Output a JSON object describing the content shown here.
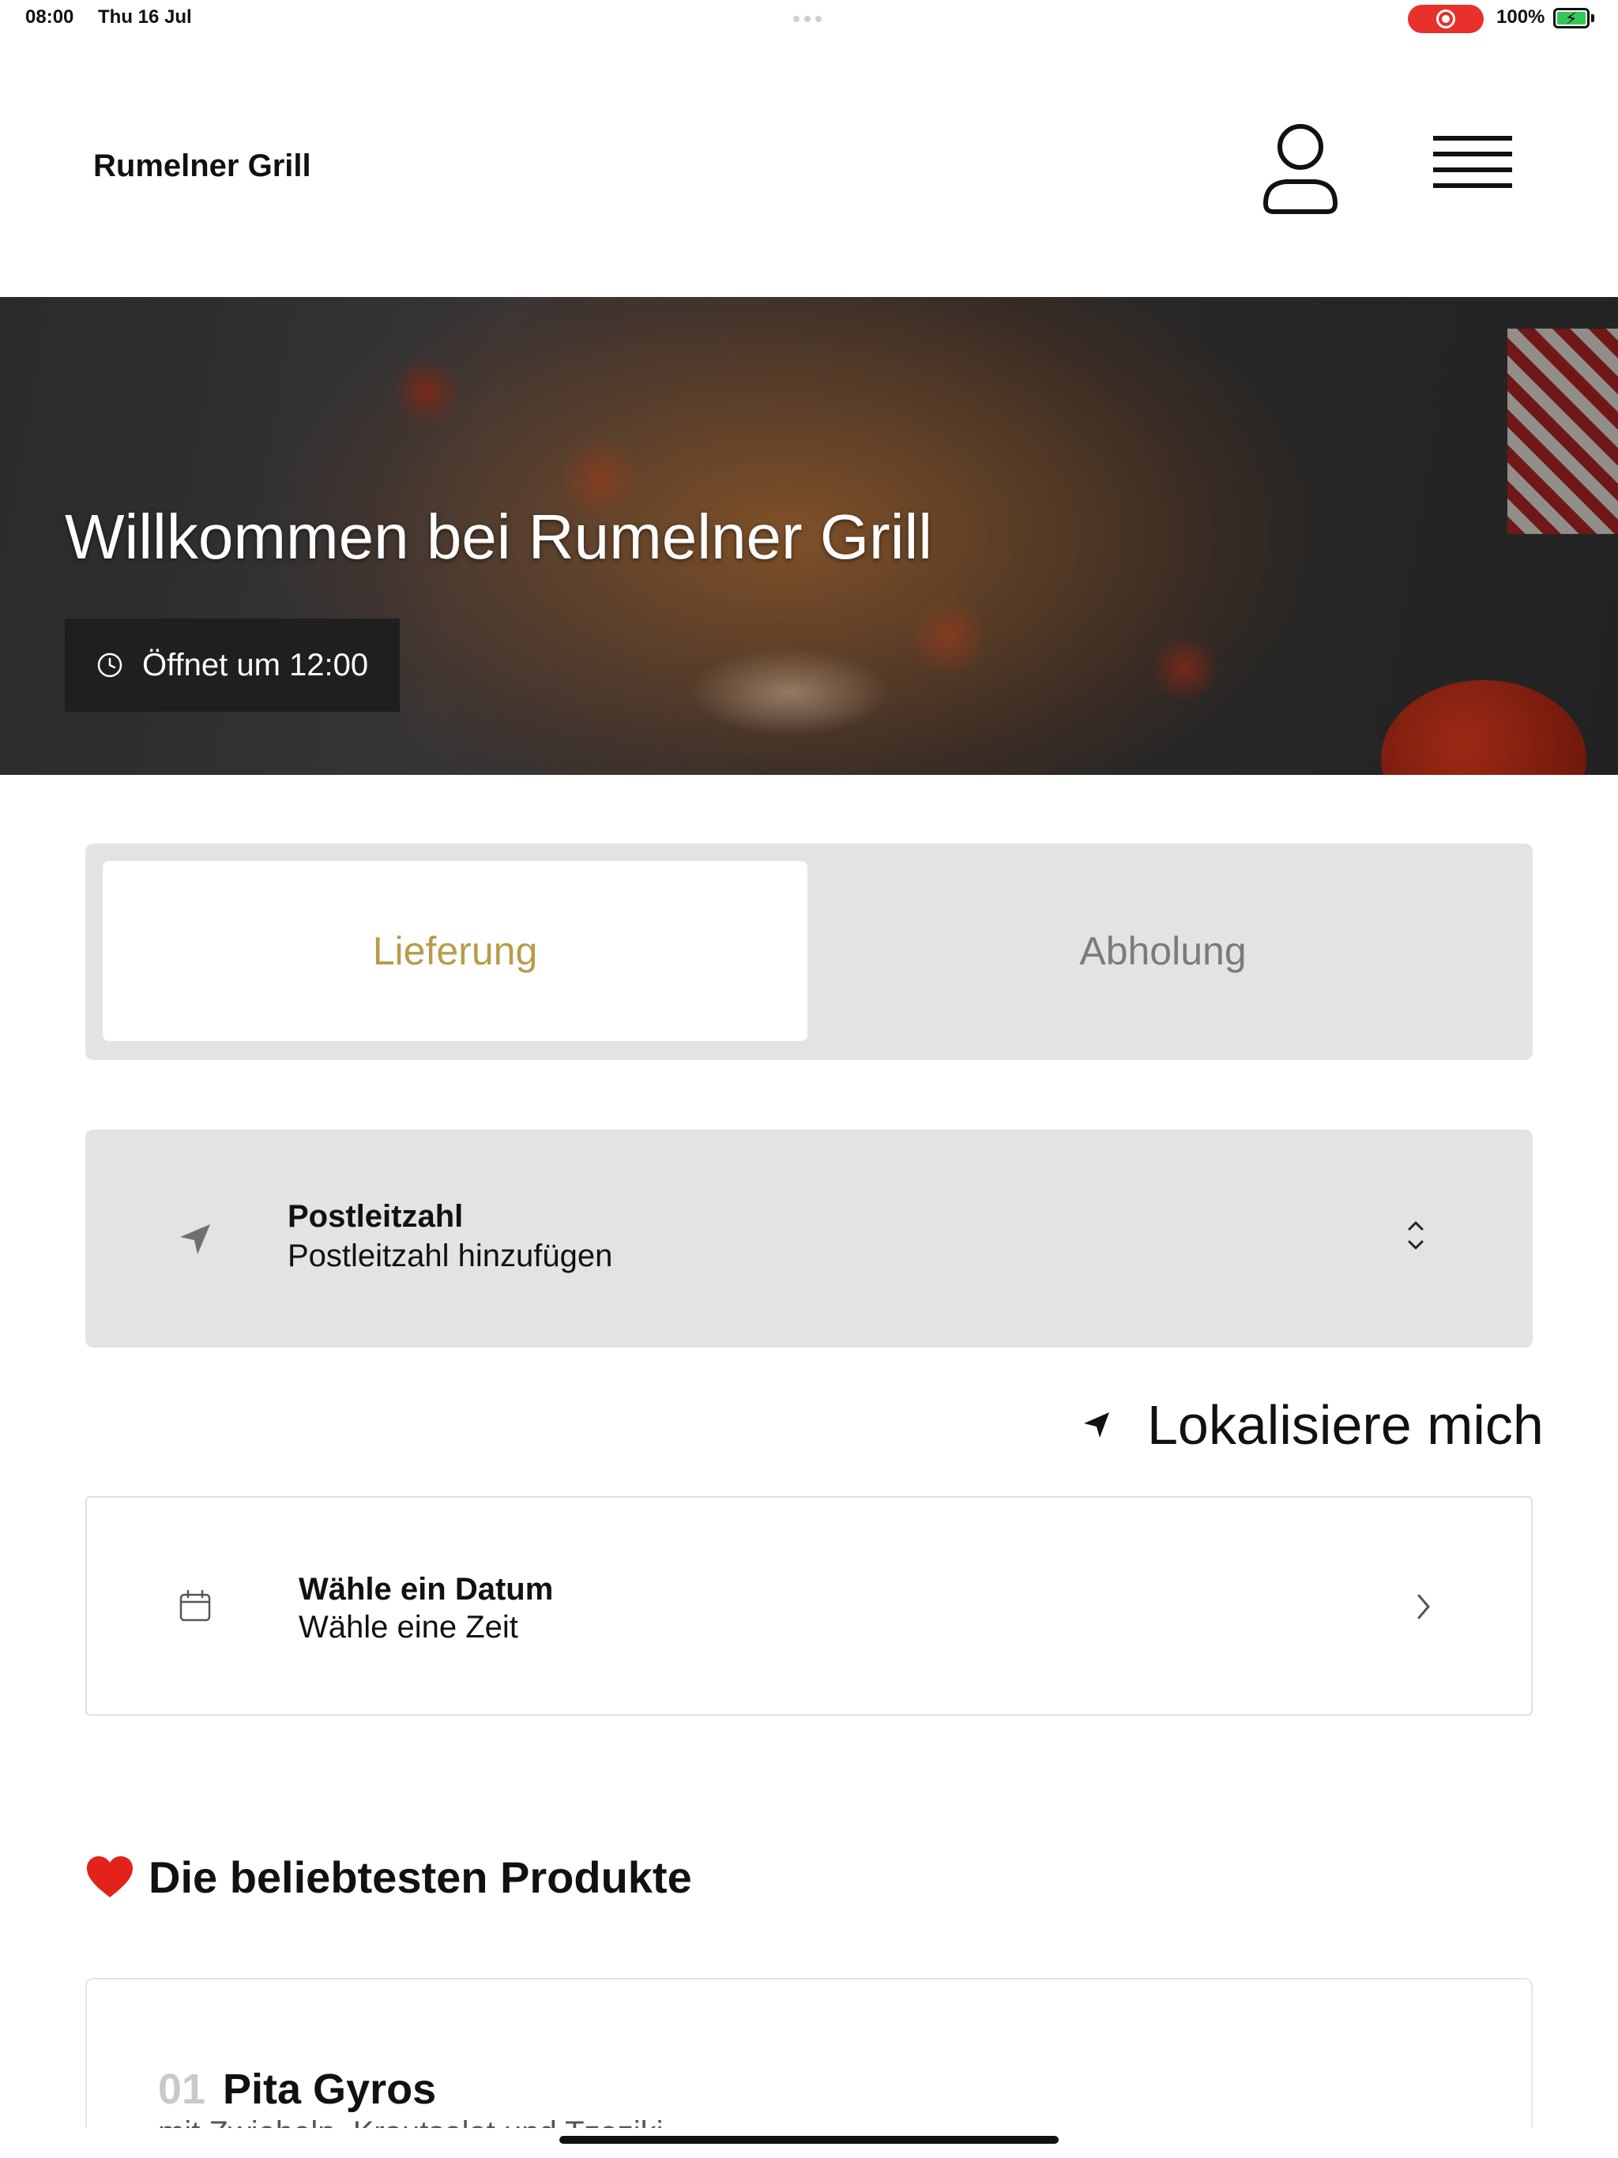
{
  "status_bar": {
    "time": "08:00",
    "date": "Thu 16 Jul",
    "battery_percent": "100%",
    "battery_level": 1.0,
    "recording_active": true
  },
  "header": {
    "brand": "Rumelner Grill",
    "icons": {
      "account": "user-icon",
      "menu": "hamburger-menu-icon"
    }
  },
  "hero": {
    "title": "Willkommen bei Rumelner Grill",
    "opening_status": "Öffnet um 12:00",
    "icon": "clock-icon"
  },
  "order_mode": {
    "options": [
      {
        "label": "Lieferung",
        "selected": true
      },
      {
        "label": "Abholung",
        "selected": false
      }
    ],
    "accent_color": "#b89c4a"
  },
  "postal_code": {
    "label": "Postleitzahl",
    "placeholder": "Postleitzahl hinzufügen",
    "icon": "navigation-arrow-icon"
  },
  "locate": {
    "label": "Lokalisiere mich",
    "icon": "location-arrow-icon"
  },
  "schedule": {
    "date_label": "Wähle ein Datum",
    "time_label": "Wähle eine Zeit",
    "icon": "calendar-icon"
  },
  "popular": {
    "heading": "Die beliebtesten Produkte",
    "heading_icon": "heart-icon",
    "products": [
      {
        "number": "01",
        "name": "Pita Gyros",
        "description": "mit Zwiebeln, Krautsalat und Tzaziki"
      }
    ]
  }
}
